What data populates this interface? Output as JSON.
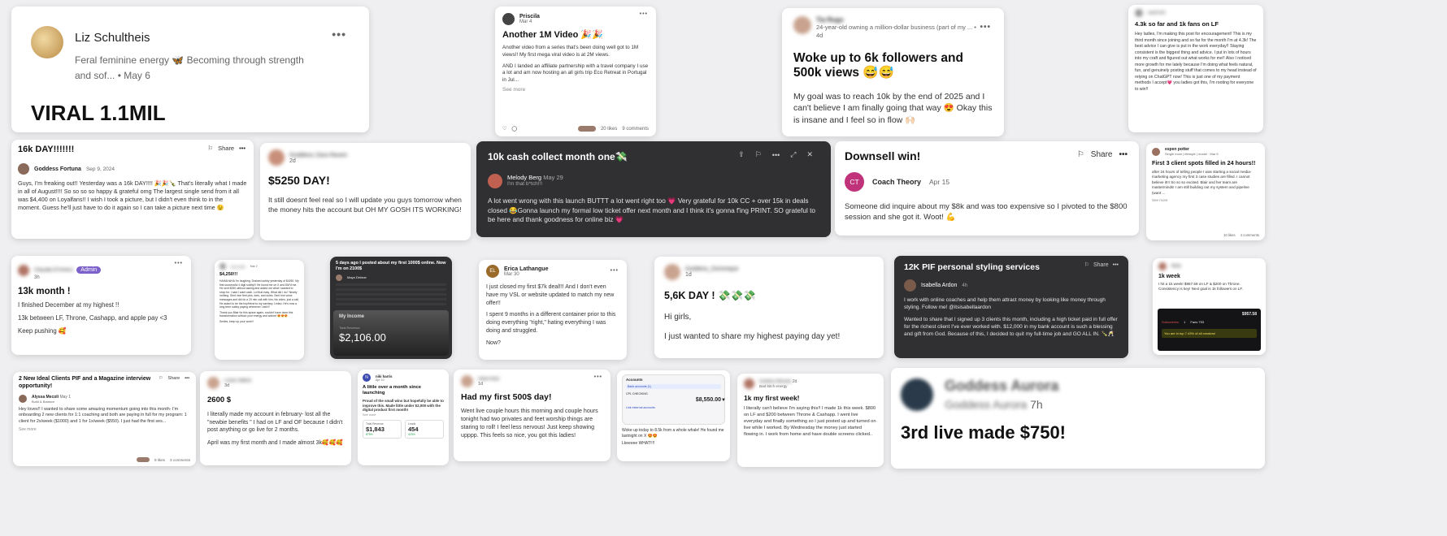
{
  "c1": {
    "name": "Liz Schultheis",
    "bio": "Feral feminine energy 🦋 Becoming through strength and sof...",
    "date": "May 6",
    "title": "VIRAL 1.1MIL",
    "dots": "•••"
  },
  "c2": {
    "name": "Priscila",
    "date": "Mar 4",
    "title": "Another 1M Video 🎉🎉",
    "body": "Another video from a series that's been doing well got to 1M views!! My first mega viral video is at 2M views.",
    "body2": "AND I landed an affiliate partnership with a travel company I use a lot and am now hosting an all girls trip Eco Retreat in Portugal in Jul...",
    "more": "See more",
    "likes": "20 likes",
    "comments": "9 comments",
    "dots": "•••"
  },
  "c3": {
    "name": "Tia Rugs",
    "bio": "24-year-old owning a million-dollar business (part of my ...",
    "date": "4d",
    "title": "Woke up to 6k followers and 500k views 😅😅",
    "body": "My goal was to reach 10k by the end of 2025 and I can't believe I am finally going that way 😍 Okay this is insane and I feel so in flow 🙌🏻",
    "dots": "•••"
  },
  "c4": {
    "name": "sarah kim",
    "title": "4.3k so far and 1k fans on LF",
    "body": "Hey ladies, I'm making this post for encouragement! This is my third month since joining and so far for the month I'm at 4.3k! The best advice I can give is put in the work everyday!! Staying consistent is the biggest thing and advice. I put in lots of hours into my craft and figured out what works for me!! Also I noticed more growth for me lately because I'm doing what feels natural, fun, and genuinely posting stuff that comes to my head instead of relying on ChatGPT now! This is just one of my payment methods I accept💗 you ladies got this, I'm rooting for everyone to win!!"
  },
  "c5": {
    "title": "16k DAY!!!!!!!",
    "share": "Share",
    "name": "Goddess Fortuna",
    "date": "Sep 9, 2024",
    "body": "Guys, I'm freaking out!! Yesterday was a 16k DAY!!!! 🎉🎉🍾 That's literally what I made in all of August!!!! So so so so happy & grateful omg The largest single send from it all was $4,400 on Loyalfans!! I wish I took a picture, but I didn't even think to in the moment. Guess he'll just have to do it again so I can take a picture next time 😉",
    "dots": "•••"
  },
  "c6": {
    "name": "Goddess Zara Raven",
    "date": "2d",
    "title": "$5250 DAY!",
    "body": "It still doesnt feel real so I will update you guys tomorrow when the money hits the account but OH MY GOSH ITS WORKING!"
  },
  "c7": {
    "title": "10k cash collect month one💸",
    "name": "Melody Berg",
    "date": "May 29",
    "sub": "I'm that b*tch!!!",
    "body": "A lot went wrong with this launch BUTTT a lot went right too 💗 Very grateful for 10k CC + over 15k in deals closed 😂Gonna launch my formal low ticket offer next month and I think it's gonna f'ing PRINT. SO grateful to be here and thank goodness for online biz 💗",
    "share_icon": "share-icon",
    "bookmark_icon": "bookmark-icon",
    "dots": "•••",
    "expand": "⤢",
    "close": "✕"
  },
  "c8": {
    "title": "Downsell win!",
    "share": "Share",
    "initials": "CT",
    "name": "Coach Theory",
    "date": "Apr 15",
    "body": "Someone did inquire about my $8k and was too expensive so I pivoted to the $800 session and she got it. Woot! 💪",
    "dots": "•••"
  },
  "c9": {
    "name": "espen potter",
    "sub": "Single mom | lifestyle | model · Mar 5",
    "title": "First 3 client spots filled in 24 hours!!",
    "body": "after 24 hours of telling people I was starting a social media-marketing agency my first 3 case studies are filled. I cannot believe it!!! So so so excited. Blair and her team are masterminds! I am still building out my system and pipeline (want ...",
    "more": "See more",
    "likes": "10 likes",
    "comments": "4 comments"
  },
  "c10": {
    "name": "Claudia D'Amico",
    "badge": "Admin",
    "date": "3h",
    "title": "13k month !",
    "body1": "I finished December at my highest !!",
    "body2": "13k between LF, Throne, Cashapp, and apple pay <3",
    "body3": "Keep pushing 🥰",
    "dots": "•••"
  },
  "c11": {
    "name": "Mel Smith",
    "date": "Mar 2",
    "title": "$4,250!!!",
    "body": "HAHAHAHA I'm laughing. Drained subby yesterday of $4250. My first successful 4 digit subby!!! He found me on X and DM'd me. He sent $250 without asking and asked me what I wanted to shop for. I said I want cash. Lol that easy. What did I do? Nearly nothing. Sent nice feet pics, toes, and soles. Sent him voice messages and did do a 20 min call with him, his video, just a call. He asked to be the boyfriend to my sanitary. Lmfao. He's now a long term subby paying whenever I ask!!!",
    "body2": "Thank you Blair for this space again, couldn't have done this transformation without your energy and advice! 😍😍😍",
    "body3": "Smiles, keep up your work!!"
  },
  "c12": {
    "title": "5 days ago I posted about my first 1000$ online. Now I'm on 2100$",
    "name": "Maya Delmar",
    "income": "My Income",
    "income_sub": "Total Revenue",
    "amount": "$2,106.00"
  },
  "c13": {
    "initials": "EL",
    "name": "Erica Lathangue",
    "date": "Mar 30",
    "body1": "I just closed my first $7k deal!!! And I don't even have my VSL or website updated to match my new offer!!",
    "body2": "I spent 9 months in a different container prior to this doing everything \"right,\" hating everything I was doing and struggled.",
    "body3": "Now?",
    "dots": "•••"
  },
  "c14": {
    "name": "Goddess_Dominique",
    "date": "1d",
    "title": "5,6K DAY ! 💸💸💸",
    "body1": "Hi girls,",
    "body2": "I just wanted to share my highest paying day yet!"
  },
  "c15": {
    "title": "12K PIF personal styling services",
    "share": "Share",
    "name": "Isabella Ardon",
    "date": "4h",
    "body1": "I work with online coaches and help them attract money by looking like money through styling. Follow me! @itsisabellaardon",
    "body2": "Wanted to share that I signed up 3 clients this month, including a high ticket paid in full offer for the richest client I've ever worked with. $12,000 in my bank account is such a blessing and gift from God. Because of this, I decided to quit my full-time job and GO ALL IN. 🍾🥂",
    "dots": "•••"
  },
  "c16": {
    "name": "Melia",
    "title": "1k week",
    "body": "I hit a 1k week! $957.58 on LF & $200 on Throne. Consistency is key! Next goal is 1k followers on LF.",
    "amount": "$957.58",
    "subs": "Subscribers",
    "subs_n": "1",
    "fans": "Fans 793",
    "banner": "You are in top 7.43% of all creators!"
  },
  "c17": {
    "title": "2 New Ideal Clients PIF and a Magazine interview opportunity!",
    "share": "Share",
    "name": "Alyssa Mecoli",
    "date": "May 1",
    "sub": "Build & Balance",
    "body": "Hey loves!! I wanted to share some amazing momentum going into this month- I'm onboarding 2 new clients for 1:1 coaching and both are paying in full for my program: 1 client for 2x/week ($1000) and 1 for 1x/week ($550). I just had the first ses...",
    "more": "See more",
    "likes": "9 likes",
    "comments": "3 comments"
  },
  "c18": {
    "name": "Lucia Valera",
    "date": "3d",
    "title": "2600 $",
    "body1": "I literally made my account in february- lost all the \"newbie benefits \" I had on LF and OF because I didn't post anything or go live for 2 months.",
    "body2": "April was my first month and I made almost 3k🥰🥰🥰"
  },
  "c19": {
    "initials": "N",
    "name": "niki harris",
    "date": "Apr 10",
    "title": "A little over a month since launching",
    "body": "Proud of the small wins but hopefully be able to improve this. Made little under $2,000 with the digital product first month!",
    "more": "See more",
    "revenue_label": "Total Revenue",
    "revenue": "$1,843",
    "revenue_delta": "875%",
    "leads_label": "Leads",
    "leads": "454",
    "leads_delta": "423%"
  },
  "c20": {
    "name": "Sara Ruiz",
    "date": "1d",
    "title": "Had my first 500$ day!",
    "body": "Went live couple hours this morning and couple hours tonight had two privates and feet worship things are staring to roll! I feel less nervous! Just keep showing upppp. This feels so nice, you got this ladies!",
    "dots": "•••"
  },
  "c21": {
    "header": "Accounts",
    "acc": "Bank accounts (1)",
    "check": "CPL CHECKING",
    "bal": "$8,550.00",
    "link": "Link external accounts",
    "body1": "Woke up today to 8.5k from a whole whale! He found me lastnight on X 😍😍",
    "body2": "Lkeeeee WHAT!!!!"
  },
  "c22": {
    "name": "Goddess Miranda",
    "date": "2d",
    "sub": "Bad bitch energy",
    "title": "1k my first week!",
    "body": "I literally can't believe I'm saying this!! I made 1k this week. $800 on LF and $200 between Throne & Cashapp. I went live everyday and finally something so I just posted up and turned on live while I worked. By Wednesday the money just started flowing in. I work from home and have double screens clicked.."
  },
  "c23": {
    "name": "Goddess Aurora",
    "sub": "Goddess Aurora",
    "date": "7h",
    "title": "3rd live made $750!"
  }
}
